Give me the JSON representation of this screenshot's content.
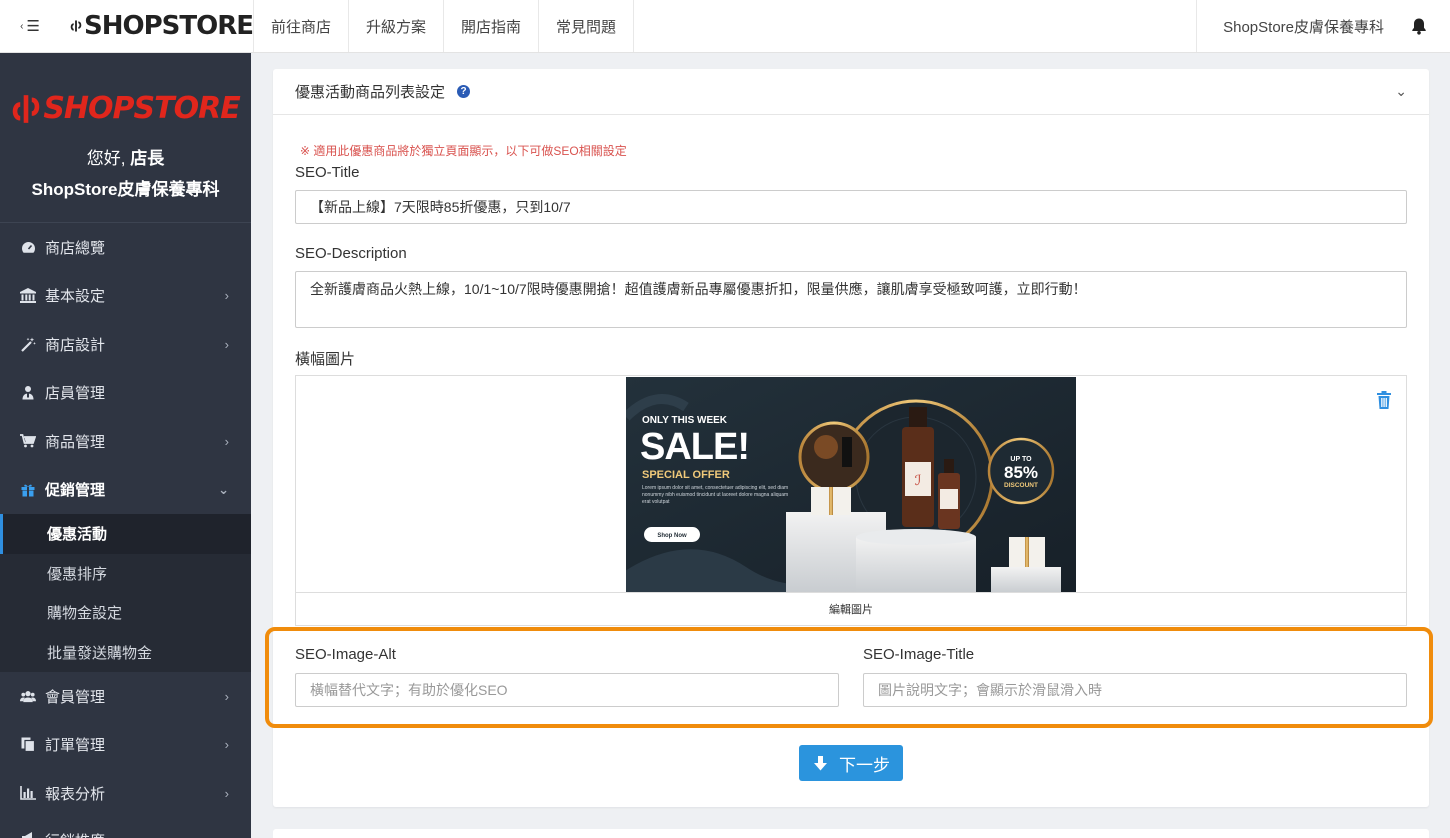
{
  "topbar": {
    "logo": "SHOPSTORE",
    "nav": [
      "前往商店",
      "升級方案",
      "開店指南",
      "常見問題"
    ],
    "store_name": "ShopStore皮膚保養專科"
  },
  "sidebar": {
    "logo": "SHOPSTORE",
    "greeting_prefix": "您好, ",
    "greeting_name": "店長",
    "store_name": "ShopStore皮膚保養專科",
    "items": [
      {
        "label": "商店總覽",
        "icon": "dashboard-icon"
      },
      {
        "label": "基本設定",
        "icon": "bank-icon"
      },
      {
        "label": "商店設計",
        "icon": "magic-wand-icon"
      },
      {
        "label": "店員管理",
        "icon": "staff-icon"
      },
      {
        "label": "商品管理",
        "icon": "cart-icon"
      },
      {
        "label": "促銷管理",
        "icon": "gift-icon"
      },
      {
        "label": "會員管理",
        "icon": "users-icon"
      },
      {
        "label": "訂單管理",
        "icon": "copy-icon"
      },
      {
        "label": "報表分析",
        "icon": "bar-chart-icon"
      },
      {
        "label": "行銷推廣",
        "icon": "megaphone-icon"
      }
    ],
    "sub_items": [
      "優惠活動",
      "優惠排序",
      "購物金設定",
      "批量發送購物金"
    ]
  },
  "panel": {
    "title": "優惠活動商品列表設定",
    "notice": "※ 適用此優惠商品將於獨立頁面顯示，以下可做SEO相關設定",
    "seo_title_label": "SEO-Title",
    "seo_title_value": "【新品上線】7天限時85折優惠，只到10/7",
    "seo_desc_label": "SEO-Description",
    "seo_desc_value": "全新護膚商品火熱上線，10/1~10/7限時優惠開搶！超值護膚新品專屬優惠折扣，限量供應，讓肌膚享受極致呵護，立即行動！",
    "banner_label": "橫幅圖片",
    "edit_image": "編輯圖片",
    "alt_label": "SEO-Image-Alt",
    "alt_placeholder": "橫幅替代文字；有助於優化SEO",
    "img_title_label": "SEO-Image-Title",
    "img_title_placeholder": "圖片說明文字；會顯示於滑鼠滑入時",
    "next_label": "下一步"
  },
  "banner": {
    "line1": "ONLY THIS WEEK",
    "line2": "SALE!",
    "line3": "SPECIAL OFFER",
    "body": "Lorem ipsum dolor sit amet, consectetuer adipiscing elit, sed diam nonummy nibh euismod tincidunt ut laoreet dolore magna aliquam erat volutpat",
    "button": "Shop Now",
    "badge_top": "UP TO",
    "badge_value": "85%",
    "badge_bottom": "DISCOUNT"
  }
}
